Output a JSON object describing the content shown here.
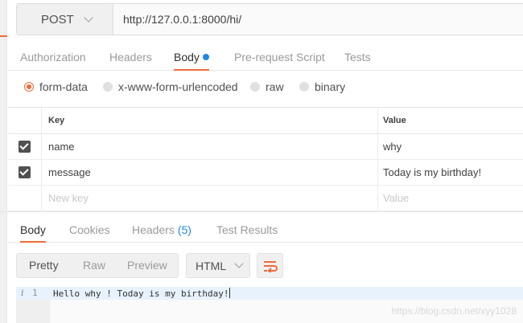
{
  "request": {
    "method": "POST",
    "url": "http://127.0.0.1:8000/hi/"
  },
  "request_tabs": [
    {
      "label": "Authorization"
    },
    {
      "label": "Headers"
    },
    {
      "label": "Body"
    },
    {
      "label": "Pre-request Script"
    },
    {
      "label": "Tests"
    }
  ],
  "body_types": [
    {
      "label": "form-data",
      "selected": true
    },
    {
      "label": "x-www-form-urlencoded",
      "selected": false
    },
    {
      "label": "raw",
      "selected": false
    },
    {
      "label": "binary",
      "selected": false
    }
  ],
  "form_table": {
    "headers": {
      "key": "Key",
      "value": "Value"
    },
    "rows": [
      {
        "checked": true,
        "key": "name",
        "value": "why"
      },
      {
        "checked": true,
        "key": "message",
        "value": "Today is my birthday!"
      }
    ],
    "new_row": {
      "key_placeholder": "New key",
      "value_placeholder": "Value"
    }
  },
  "response_tabs": {
    "body": "Body",
    "cookies": "Cookies",
    "headers": "Headers",
    "headers_count": "(5)",
    "test_results": "Test Results"
  },
  "response_toolbar": {
    "pretty": "Pretty",
    "raw": "Raw",
    "preview": "Preview",
    "format": "HTML"
  },
  "response_body": {
    "line_number": "1",
    "line_icon": "i",
    "text": "Hello why ! Today is my birthday!"
  },
  "watermark": "https://blog.csdn.net/xyy1028",
  "colors": {
    "accent": "#f26b3a",
    "indicator": "#1e88e5"
  }
}
